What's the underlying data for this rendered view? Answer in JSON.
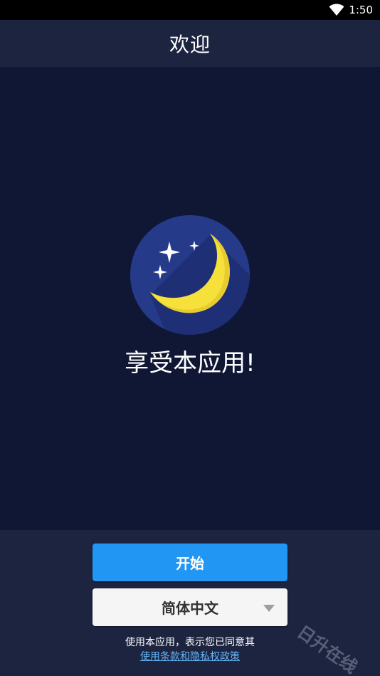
{
  "status_bar": {
    "time": "1:50",
    "wifi_icon": "wifi-icon"
  },
  "app_bar": {
    "title": "欢迎"
  },
  "main": {
    "logo_icon": "moon-stars-icon",
    "tagline": "享受本应用!"
  },
  "actions": {
    "start_label": "开始",
    "language_value": "简体中文",
    "dropdown_icon": "chevron-down-icon"
  },
  "footer": {
    "terms_text": "使用本应用，表示您已同意其",
    "terms_link": "使用条款和隐私权政策"
  },
  "watermark": "日升在线",
  "colors": {
    "background": "#0f1735",
    "bar": "#1c2440",
    "accent": "#2196f3",
    "link": "#64b5f6",
    "moon": "#f6e03a",
    "logo_circle": "#263a8a"
  }
}
